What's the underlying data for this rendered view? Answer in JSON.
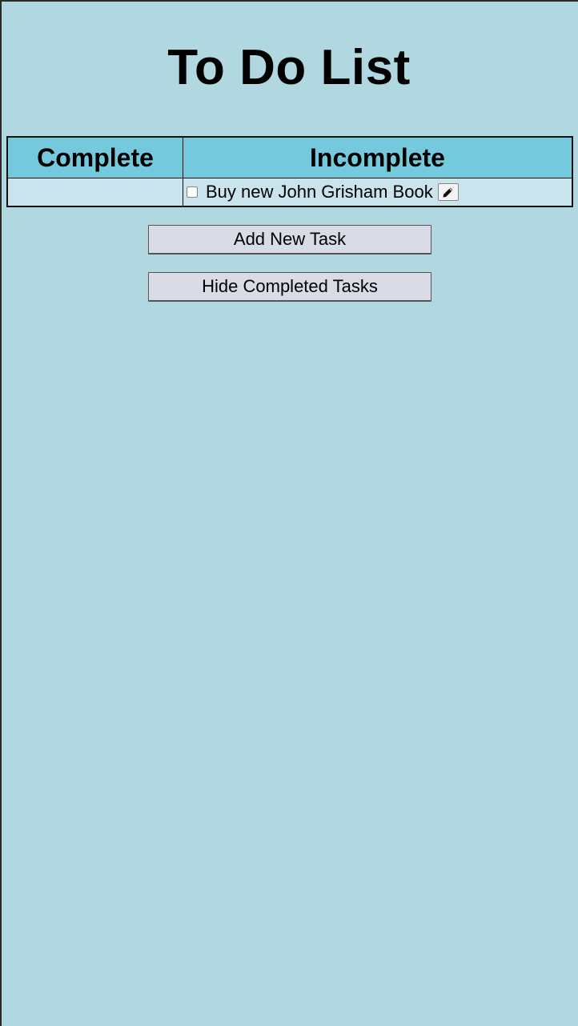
{
  "page": {
    "title": "To Do List"
  },
  "table": {
    "headers": {
      "complete": "Complete",
      "incomplete": "Incomplete"
    },
    "complete_tasks": [],
    "incomplete_tasks": [
      {
        "text": "Buy new John Grisham Book",
        "checked": false,
        "edit_icon": "pencil-icon"
      }
    ]
  },
  "buttons": {
    "add_task": "Add New Task",
    "hide_completed": "Hide Completed Tasks"
  },
  "colors": {
    "background": "#b1d8e1",
    "header_bg": "#74cadc",
    "row_bg": "#c9e4ec",
    "button_bg": "#d9dce6"
  }
}
